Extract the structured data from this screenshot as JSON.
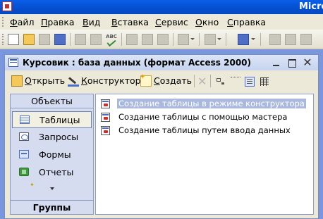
{
  "app": {
    "name": "Micros"
  },
  "menu": {
    "items": [
      {
        "label": "Файл"
      },
      {
        "label": "Правка"
      },
      {
        "label": "Вид"
      },
      {
        "label": "Вставка"
      },
      {
        "label": "Сервис"
      },
      {
        "label": "Окно"
      },
      {
        "label": "Справка"
      }
    ]
  },
  "db_window": {
    "title": "Курсовик : база данных (формат Access 2000)",
    "toolbar": {
      "open_label": "Открыть",
      "design_label": "Конструктор",
      "create_label": "Создать"
    },
    "objects_bar": {
      "header": "Объекты",
      "footer": "Группы",
      "items": [
        {
          "label": "Таблицы",
          "icon": "table-icon",
          "active": true
        },
        {
          "label": "Запросы",
          "icon": "query-icon"
        },
        {
          "label": "Формы",
          "icon": "form-icon"
        },
        {
          "label": "Отчеты",
          "icon": "report-icon"
        }
      ]
    },
    "list": {
      "items": [
        {
          "label": "Создание таблицы в режиме конструктора",
          "state": "selected"
        },
        {
          "label": "Создание таблицы с помощью мастера"
        },
        {
          "label": "Создание таблицы путем ввода данных"
        }
      ]
    }
  },
  "colors": {
    "title_bar": "#0553d6",
    "selection": "#316ac5",
    "objects_bar_bg": "#d5dcf0",
    "menu_bg": "#ece9d8"
  }
}
